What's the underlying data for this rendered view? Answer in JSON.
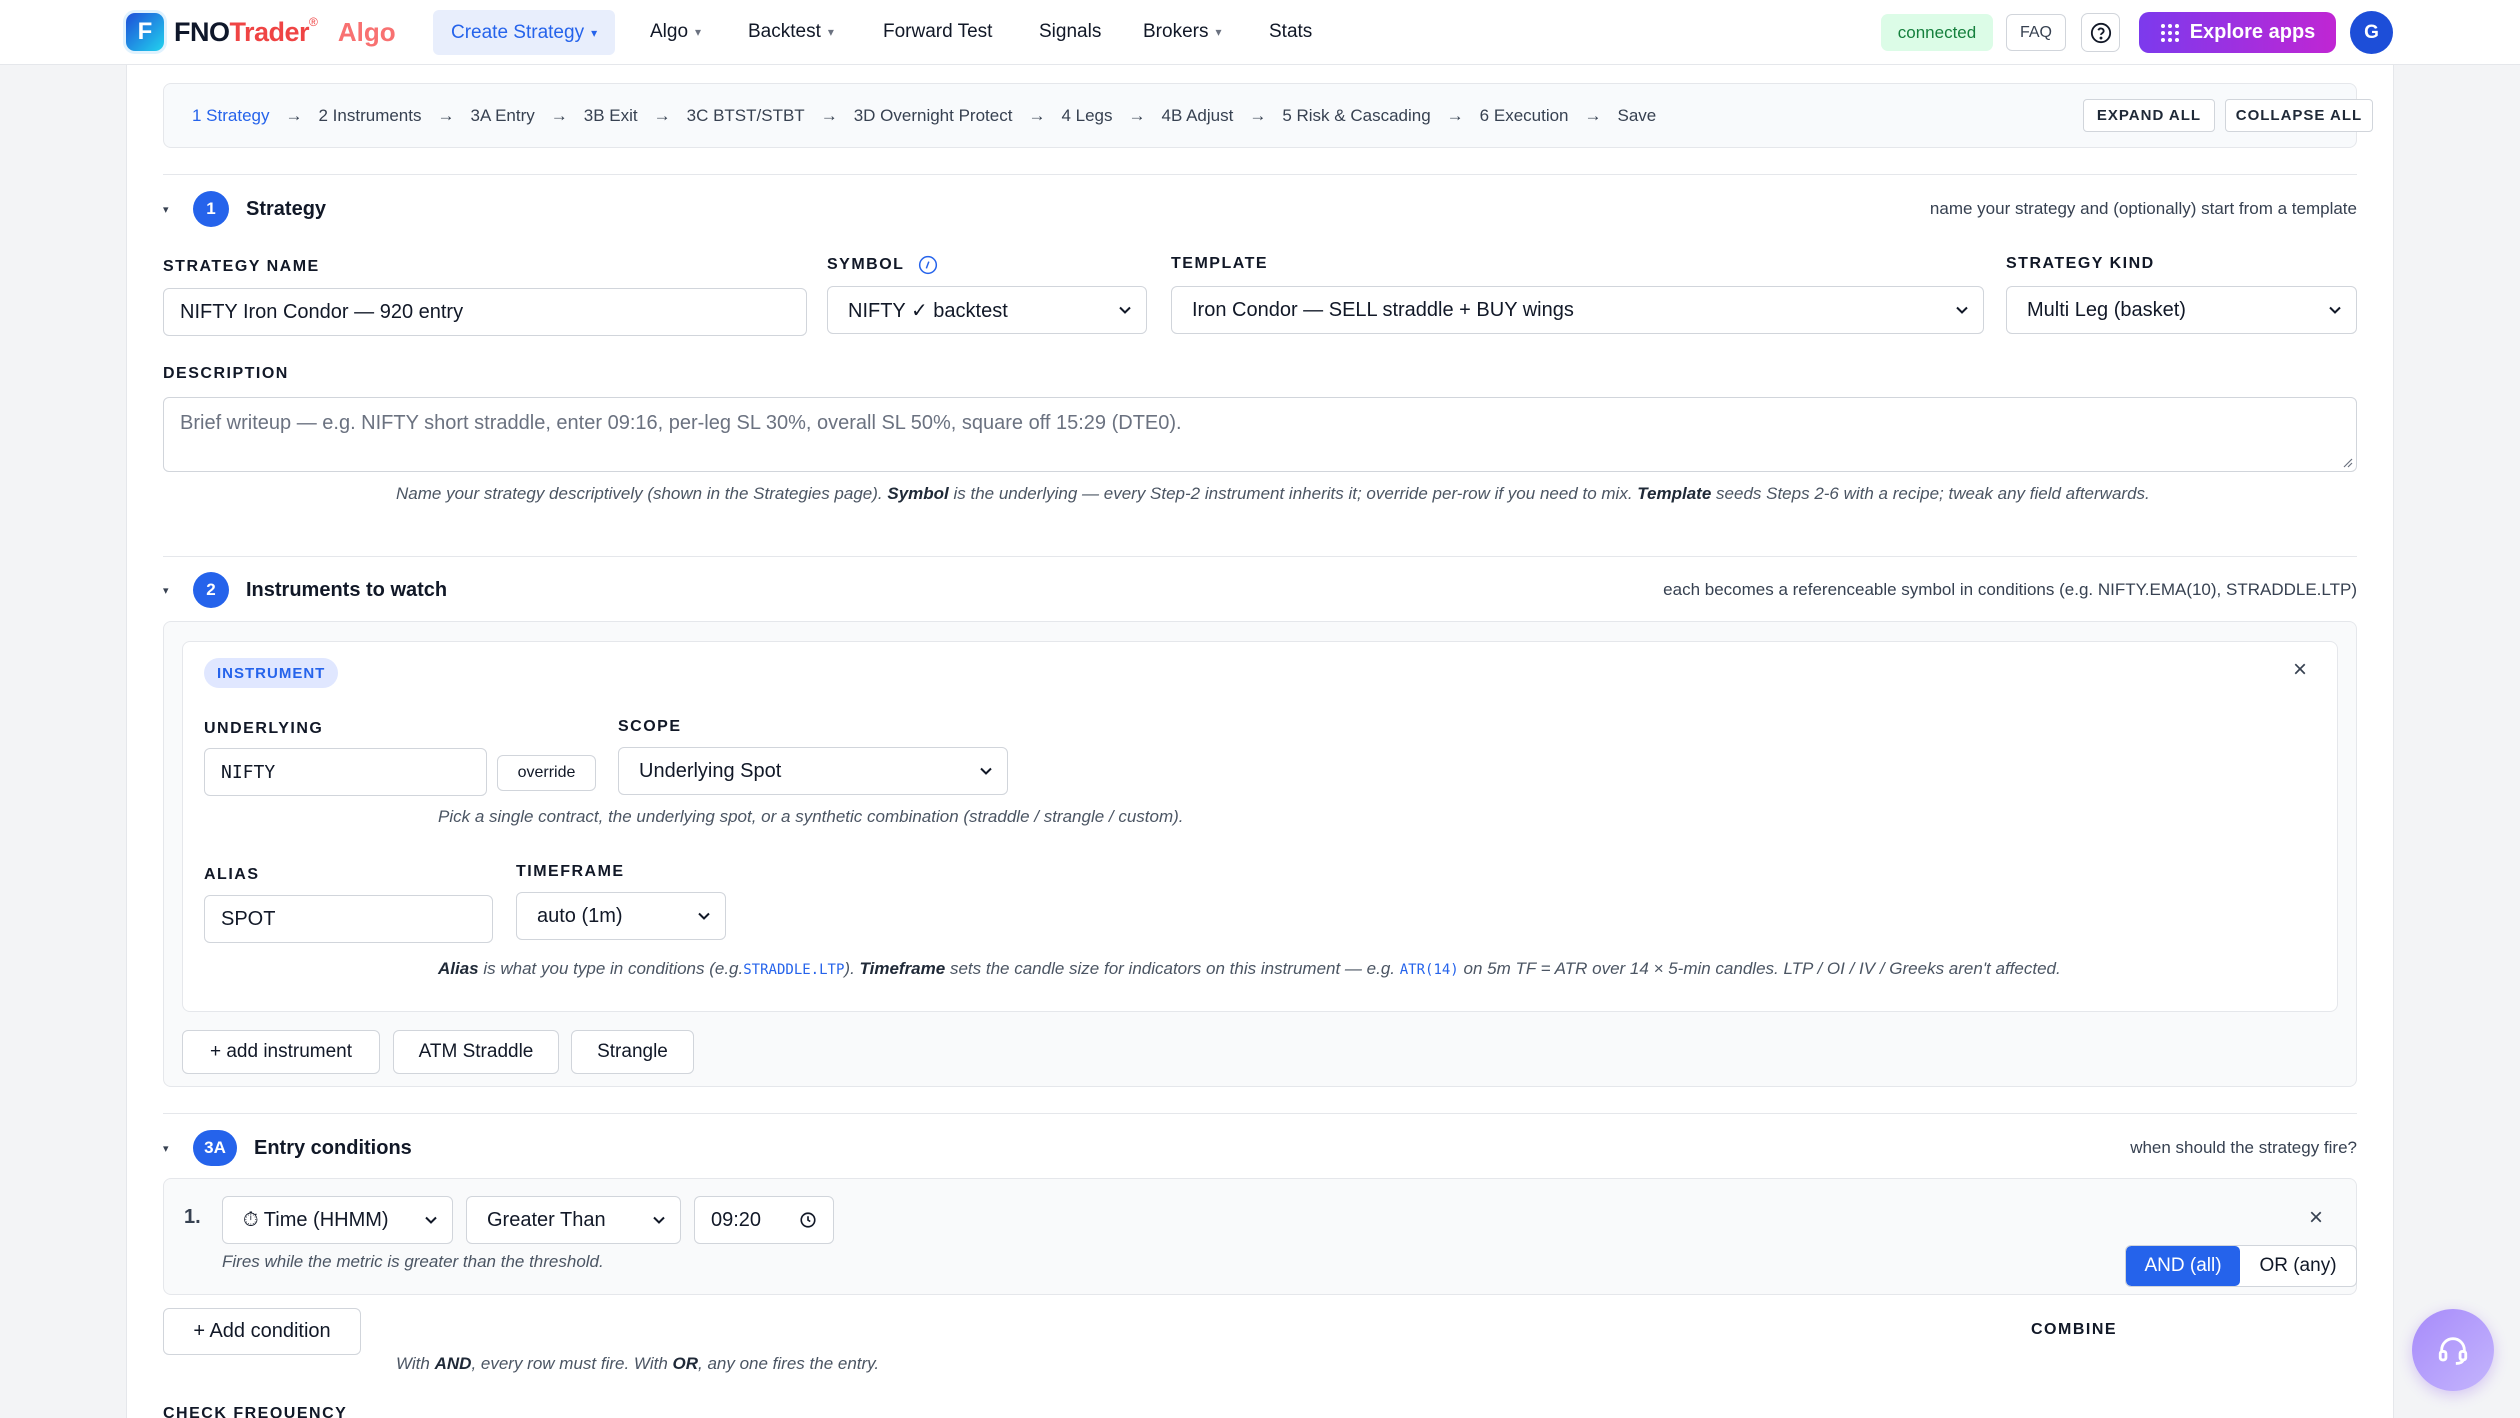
{
  "brand": {
    "name_a": "FNO",
    "name_b": "Trader",
    "reg": "®",
    "product": "Algo"
  },
  "nav": {
    "create_strategy": "Create Strategy",
    "algo": "Algo",
    "backtest": "Backtest",
    "forward_test": "Forward Test",
    "signals": "Signals",
    "brokers": "Brokers",
    "stats": "Stats",
    "caret": "▾"
  },
  "header": {
    "status": "connected",
    "faq": "FAQ",
    "explore": "Explore apps",
    "avatar": "G"
  },
  "stepper": {
    "steps": [
      "1 Strategy",
      "2 Instruments",
      "3A Entry",
      "3B Exit",
      "3C BTST/STBT",
      "3D Overnight Protect",
      "4 Legs",
      "4B Adjust",
      "5 Risk & Cascading",
      "6 Execution",
      "Save"
    ],
    "arrow": "→",
    "expand_all": "EXPAND ALL",
    "collapse_all": "COLLAPSE ALL"
  },
  "section1": {
    "toggle": "▾",
    "num": "1",
    "title": "Strategy",
    "hint": "name your strategy and (optionally) start from a template",
    "strategy_name_label": "STRATEGY NAME",
    "strategy_name_value": "NIFTY Iron Condor — 920 entry",
    "symbol_label": "SYMBOL",
    "symbol_value": "NIFTY ✓ backtest",
    "template_label": "TEMPLATE",
    "template_value": "Iron Condor — SELL straddle + BUY wings",
    "kind_label": "STRATEGY KIND",
    "kind_value": "Multi Leg (basket)",
    "description_label": "DESCRIPTION",
    "description_placeholder": "Brief writeup — e.g. NIFTY short straddle, enter 09:16, per-leg SL 30%, overall SL 50%, square off 15:29 (DTE0).",
    "help_1": "Name your strategy descriptively (shown in the Strategies page).",
    "help_symbol": "Symbol",
    "help_2": "is the underlying — every Step-2 instrument inherits it; override per-row if you need to mix.",
    "help_template": "Template",
    "help_3": "seeds Steps 2-6 with a recipe; tweak any field afterwards."
  },
  "section2": {
    "toggle": "▾",
    "num": "2",
    "title": "Instruments to watch",
    "hint": "each becomes a referenceable symbol in conditions (e.g. NIFTY.EMA(10), STRADDLE.LTP)",
    "badge": "INSTRUMENT",
    "remove": "×",
    "underlying_label": "UNDERLYING",
    "underlying_value": "NIFTY",
    "override": "override",
    "scope_label": "SCOPE",
    "scope_value": "Underlying Spot",
    "scope_help": "Pick a single contract, the underlying spot, or a synthetic combination (straddle / strangle / custom).",
    "alias_label": "ALIAS",
    "alias_value": "SPOT",
    "timeframe_label": "TIMEFRAME",
    "timeframe_value": "auto (1m)",
    "alias_help_b1": "Alias",
    "alias_help_1": "is what you type in conditions (e.g.",
    "alias_help_code1": "STRADDLE.LTP",
    "alias_help_2": ").",
    "alias_help_b2": "Timeframe",
    "alias_help_3": "sets the candle size for indicators on this instrument — e.g.",
    "alias_help_code2": "ATR(14)",
    "alias_help_4": "on 5m TF = ATR over 14 × 5-min candles. LTP / OI / IV / Greeks aren't affected.",
    "add_instrument": "+ add instrument",
    "atm_straddle": "ATM Straddle",
    "strangle": "Strangle"
  },
  "section3a": {
    "toggle": "▾",
    "num": "3A",
    "title": "Entry conditions",
    "hint": "when should the strategy fire?",
    "row_index": "1.",
    "metric": "⏱ Time (HHMM)",
    "operator": "Greater Than",
    "time_value": "09:20",
    "remove": "×",
    "row_help": "Fires while the metric is greater than the threshold.",
    "add_condition": "+ Add condition",
    "combine_label": "COMBINE",
    "and_label": "AND (all)",
    "or_label": "OR (any)",
    "combine_help_1": "With",
    "combine_help_and": "AND",
    "combine_help_2": ", every row must fire. With",
    "combine_help_or": "OR",
    "combine_help_3": ", any one fires the entry.",
    "check_frequency_label": "CHECK FREQUENCY"
  },
  "colors": {
    "primary": "#2563eb",
    "connected_bg": "#dcfce7",
    "connected_fg": "#15803d",
    "explore_from": "#7c3aed",
    "explore_to": "#c026d3",
    "trader_red": "#ef4444"
  },
  "icons": {
    "help": "question-circle-icon",
    "apps": "grid-icon",
    "clock": "clock-icon",
    "info": "info-icon",
    "support": "headset-icon",
    "select": "chevron-down-icon"
  }
}
